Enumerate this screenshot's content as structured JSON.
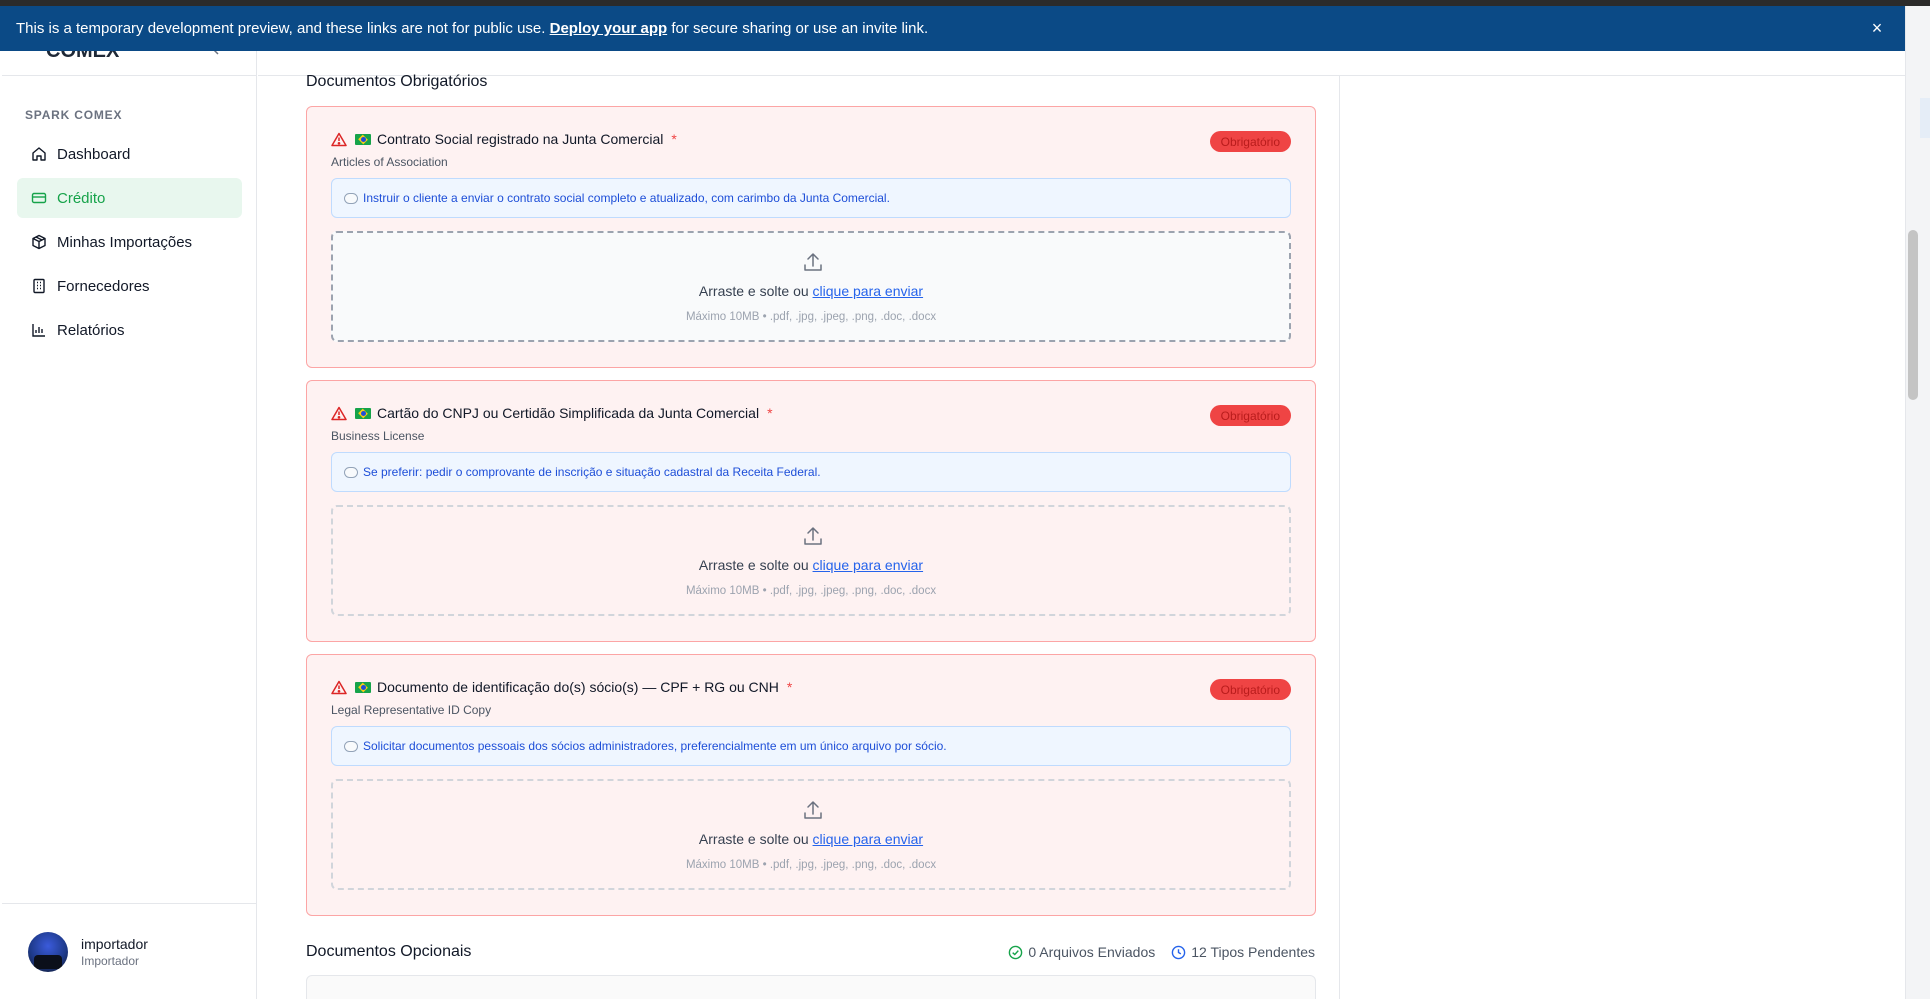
{
  "banner": {
    "text_before": "This is a temporary development preview, and these links are not for public use.",
    "link": "Deploy your app",
    "text_after": "for secure sharing or use an invite link.",
    "close": "×"
  },
  "sidebar": {
    "logo_text": "COMEX",
    "section_label": "SPARK COMEX",
    "items": [
      {
        "label": "Dashboard",
        "icon": "home-icon"
      },
      {
        "label": "Crédito",
        "icon": "credit-card-icon",
        "active": true
      },
      {
        "label": "Minhas Importações",
        "icon": "package-icon"
      },
      {
        "label": "Fornecedores",
        "icon": "building-icon"
      },
      {
        "label": "Relatórios",
        "icon": "bar-chart-icon"
      }
    ],
    "user": {
      "name": "importador",
      "role": "Importador"
    }
  },
  "main": {
    "required_title": "Documentos Obrigatórios",
    "documents": [
      {
        "title": "Contrato Social registrado na Junta Comercial",
        "subtitle": "Articles of Association",
        "badge": "Obrigatório",
        "note": "Instruir o cliente a enviar o contrato social completo e atualizado, com carimbo da Junta Comercial.",
        "drop_text": "Arraste e solte ou",
        "drop_link": "clique para enviar",
        "drop_hint": "Máximo 10MB • .pdf, .jpg, .jpeg, .png, .doc, .docx"
      },
      {
        "title": "Cartão do CNPJ ou Certidão Simplificada da Junta Comercial",
        "subtitle": "Business License",
        "badge": "Obrigatório",
        "note": "Se preferir: pedir o comprovante de inscrição e situação cadastral da Receita Federal.",
        "drop_text": "Arraste e solte ou",
        "drop_link": "clique para enviar",
        "drop_hint": "Máximo 10MB • .pdf, .jpg, .jpeg, .png, .doc, .docx"
      },
      {
        "title": "Documento de identificação do(s) sócio(s) — CPF + RG ou CNH",
        "subtitle": "Legal Representative ID Copy",
        "badge": "Obrigatório",
        "note": "Solicitar documentos pessoais dos sócios administradores, preferencialmente em um único arquivo por sócio.",
        "drop_text": "Arraste e solte ou",
        "drop_link": "clique para enviar",
        "drop_hint": "Máximo 10MB • .pdf, .jpg, .jpeg, .png, .doc, .docx"
      }
    ],
    "optional_title": "Documentos Opcionais",
    "stats": {
      "sent": "0 Arquivos Enviados",
      "pending": "12 Tipos Pendentes"
    }
  },
  "colors": {
    "banner": "#0b4a86",
    "accent": "#16a34a",
    "required_badge": "#ef4444",
    "card_bg": "#fef2f2",
    "note_text": "#1d4ed8"
  }
}
